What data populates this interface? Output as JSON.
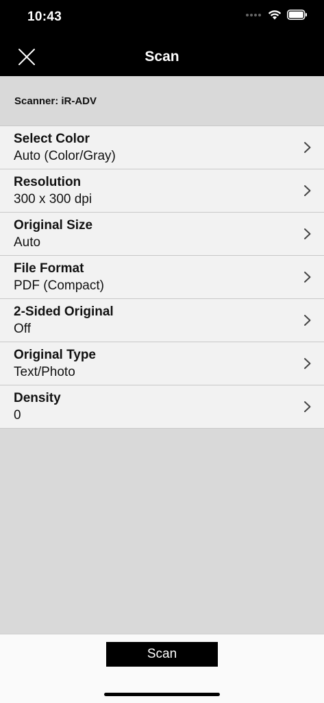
{
  "status_bar": {
    "time": "10:43"
  },
  "nav": {
    "title": "Scan",
    "close_icon": "close-icon"
  },
  "scanner": {
    "label": "Scanner: iR-ADV"
  },
  "settings": [
    {
      "title": "Select Color",
      "value": "Auto (Color/Gray)"
    },
    {
      "title": "Resolution",
      "value": "300 x 300 dpi"
    },
    {
      "title": "Original Size",
      "value": "Auto"
    },
    {
      "title": "File Format",
      "value": "PDF (Compact)"
    },
    {
      "title": "2-Sided Original",
      "value": "Off"
    },
    {
      "title": "Original Type",
      "value": "Text/Photo"
    },
    {
      "title": "Density",
      "value": "0"
    }
  ],
  "footer": {
    "scan_label": "Scan"
  },
  "colors": {
    "header_bg": "#000000",
    "list_bg": "#f2f2f2",
    "page_bg": "#d9d9d9",
    "button_bg": "#000000"
  }
}
